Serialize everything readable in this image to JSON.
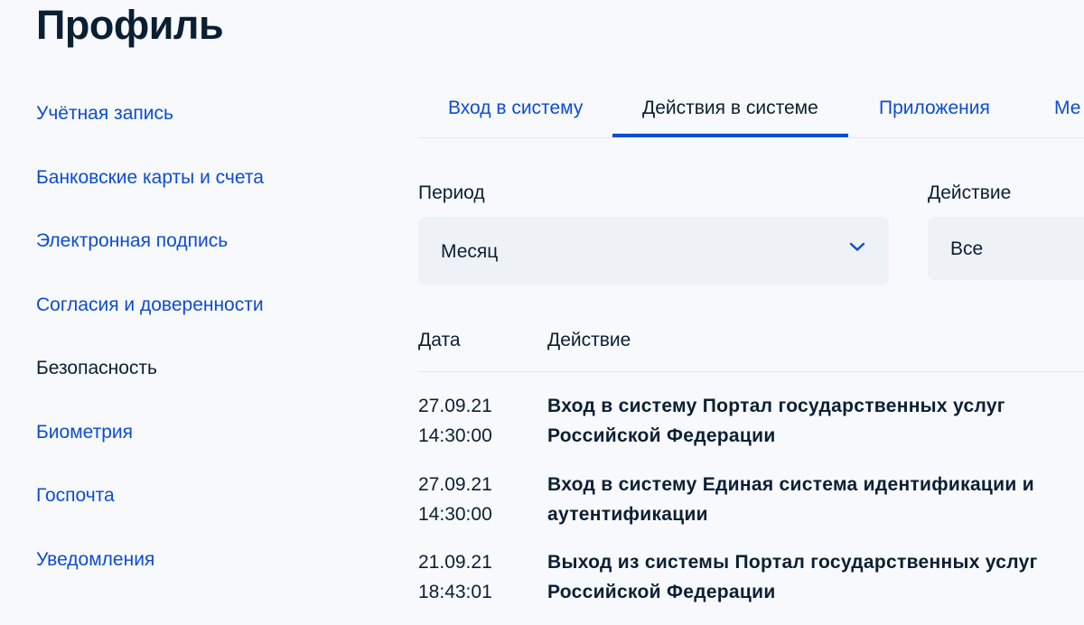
{
  "page": {
    "title": "Профиль"
  },
  "sidebar": {
    "items": [
      {
        "label": "Учётная запись",
        "active": false
      },
      {
        "label": "Банковские карты и счета",
        "active": false
      },
      {
        "label": "Электронная подпись",
        "active": false
      },
      {
        "label": "Согласия и доверенности",
        "active": false
      },
      {
        "label": "Безопасность",
        "active": true
      },
      {
        "label": "Биометрия",
        "active": false
      },
      {
        "label": "Госпочта",
        "active": false
      },
      {
        "label": "Уведомления",
        "active": false
      }
    ]
  },
  "tabs": [
    {
      "label": "Вход в систему",
      "active": false
    },
    {
      "label": "Действия в системе",
      "active": true
    },
    {
      "label": "Приложения",
      "active": false
    },
    {
      "label": "Ме",
      "active": false
    }
  ],
  "filters": {
    "period": {
      "label": "Период",
      "value": "Месяц"
    },
    "action": {
      "label": "Действие",
      "value": "Все"
    }
  },
  "table": {
    "headers": {
      "date": "Дата",
      "action": "Действие"
    },
    "rows": [
      {
        "date": "27.09.21",
        "time": "14:30:00",
        "action": "Вход в систему Портал государственных услуг Российской Федерации"
      },
      {
        "date": "27.09.21",
        "time": "14:30:00",
        "action": "Вход в систему Единая система идентификации и аутентификации"
      },
      {
        "date": "21.09.21",
        "time": "18:43:01",
        "action": "Выход из системы Портал государственных услуг Российской Федерации"
      }
    ]
  },
  "colors": {
    "link": "#0d4cd3",
    "text": "#0b1f33",
    "background": "#f8f9fd",
    "select_bg": "#eef1f6"
  },
  "icons": {
    "dropdown": "chevron-down-icon"
  }
}
